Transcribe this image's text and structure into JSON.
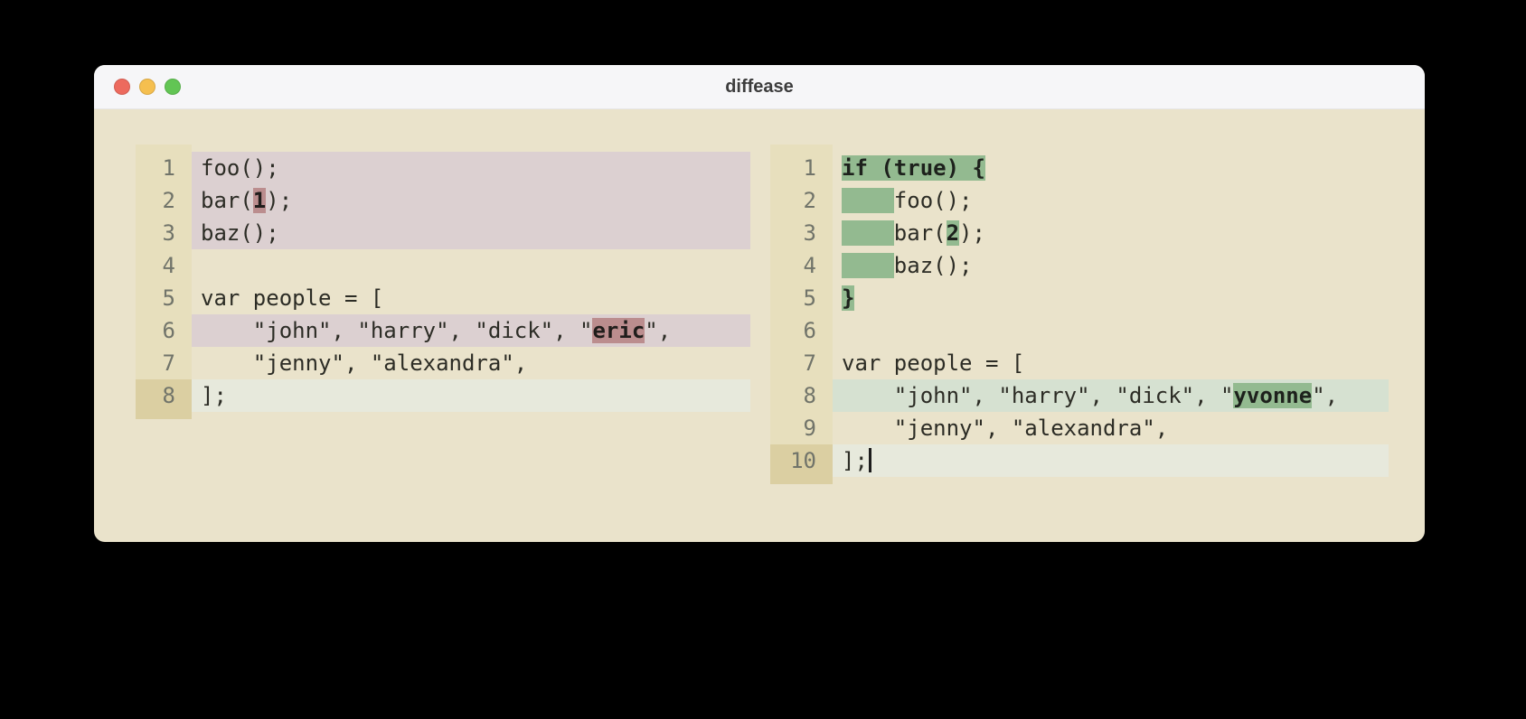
{
  "window": {
    "title": "diffease"
  },
  "titlebar": {
    "buttons": [
      {
        "name": "close",
        "color": "#ed6a5e"
      },
      {
        "name": "minimize",
        "color": "#f5bf4f"
      },
      {
        "name": "zoom",
        "color": "#62c554"
      }
    ]
  },
  "colors": {
    "page_bg": "#eae3cb",
    "titlebar_bg": "#f6f6f8",
    "title_text": "#3c3c3c",
    "code_text": "#2c2c25",
    "line_number": "#71746a",
    "gutter_bg": "#e7dfbd",
    "gutter_active_bg": "#dbcfa2",
    "removed_line_bg": "#dcd0d1",
    "removed_word_bg": "#bb8d8e",
    "added_line_bg": "#d6e1d1",
    "added_word_bg": "#93ba90",
    "current_line_bg": "#e7e9dc",
    "cursor": "#1c1c1c"
  },
  "panes": {
    "left": {
      "lines": [
        {
          "num": "1",
          "bg": "removed",
          "segs": [
            {
              "k": "plain",
              "t": "foo();"
            }
          ]
        },
        {
          "num": "2",
          "bg": "removed",
          "segs": [
            {
              "k": "plain",
              "t": "bar("
            },
            {
              "k": "del",
              "t": "1"
            },
            {
              "k": "plain",
              "t": ");"
            }
          ]
        },
        {
          "num": "3",
          "bg": "removed",
          "segs": [
            {
              "k": "plain",
              "t": "baz();"
            }
          ]
        },
        {
          "num": "4",
          "bg": null,
          "segs": []
        },
        {
          "num": "5",
          "bg": null,
          "segs": [
            {
              "k": "plain",
              "t": "var people = ["
            }
          ]
        },
        {
          "num": "6",
          "bg": "removed",
          "segs": [
            {
              "k": "plain",
              "t": "    \"john\", \"harry\", \"dick\", \""
            },
            {
              "k": "del",
              "t": "eric"
            },
            {
              "k": "plain",
              "t": "\","
            }
          ]
        },
        {
          "num": "7",
          "bg": null,
          "segs": [
            {
              "k": "plain",
              "t": "    \"jenny\", \"alexandra\","
            }
          ]
        },
        {
          "num": "8",
          "bg": "current",
          "active": true,
          "segs": [
            {
              "k": "plain",
              "t": "];"
            }
          ]
        }
      ]
    },
    "right": {
      "lines": [
        {
          "num": "1",
          "bg": null,
          "segs": [
            {
              "k": "add",
              "t": "if (true) {"
            }
          ]
        },
        {
          "num": "2",
          "bg": null,
          "segs": [
            {
              "k": "indent",
              "t": "    "
            },
            {
              "k": "plain",
              "t": "foo();"
            }
          ]
        },
        {
          "num": "3",
          "bg": null,
          "segs": [
            {
              "k": "indent",
              "t": "    "
            },
            {
              "k": "plain",
              "t": "bar("
            },
            {
              "k": "add",
              "t": "2"
            },
            {
              "k": "plain",
              "t": ");"
            }
          ]
        },
        {
          "num": "4",
          "bg": null,
          "segs": [
            {
              "k": "indent",
              "t": "    "
            },
            {
              "k": "plain",
              "t": "baz();"
            }
          ]
        },
        {
          "num": "5",
          "bg": null,
          "segs": [
            {
              "k": "add",
              "t": "}"
            }
          ]
        },
        {
          "num": "6",
          "bg": null,
          "segs": []
        },
        {
          "num": "7",
          "bg": null,
          "segs": [
            {
              "k": "plain",
              "t": "var people = ["
            }
          ]
        },
        {
          "num": "8",
          "bg": "added",
          "segs": [
            {
              "k": "plain",
              "t": "    \"john\", \"harry\", \"dick\", \""
            },
            {
              "k": "add",
              "t": "yvonne"
            },
            {
              "k": "plain",
              "t": "\","
            }
          ]
        },
        {
          "num": "9",
          "bg": null,
          "segs": [
            {
              "k": "plain",
              "t": "    \"jenny\", \"alexandra\","
            }
          ]
        },
        {
          "num": "10",
          "bg": "current",
          "active": true,
          "cursor": true,
          "segs": [
            {
              "k": "plain",
              "t": "];"
            }
          ]
        }
      ]
    }
  }
}
